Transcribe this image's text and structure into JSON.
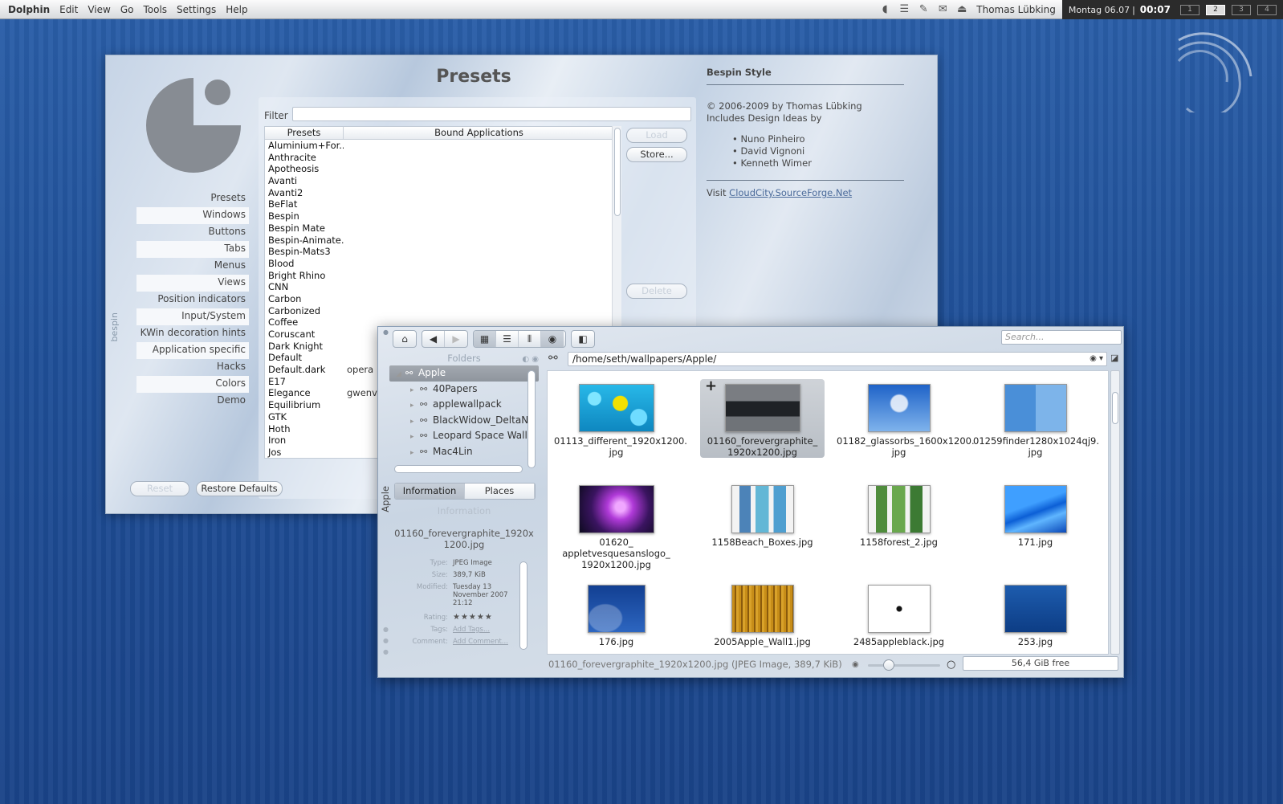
{
  "menubar": {
    "app": "Dolphin",
    "items": [
      "Edit",
      "View",
      "Go",
      "Tools",
      "Settings",
      "Help"
    ]
  },
  "tray": {
    "icons": [
      "volume-icon",
      "clipboard-icon",
      "network-icon",
      "mail-icon",
      "eject-icon"
    ],
    "user": "Thomas Lübking",
    "date": "Montag 06.07",
    "separator": "|",
    "time": "00:07",
    "desktops": [
      "1",
      "2",
      "3",
      "4"
    ],
    "active_desktop": 2
  },
  "config": {
    "title": "Presets",
    "side_label": "bespin",
    "nav": [
      {
        "label": "Presets",
        "alt": false
      },
      {
        "label": "Windows",
        "alt": true
      },
      {
        "label": "Buttons",
        "alt": false
      },
      {
        "label": "Tabs",
        "alt": true
      },
      {
        "label": "Menus",
        "alt": false
      },
      {
        "label": "Views",
        "alt": true
      },
      {
        "label": "Position indicators",
        "alt": false
      },
      {
        "label": "Input/System",
        "alt": true
      },
      {
        "label": "KWin decoration hints",
        "alt": false
      },
      {
        "label": "Application specific",
        "alt": true
      },
      {
        "label": "Hacks",
        "alt": false
      },
      {
        "label": "Colors",
        "alt": true
      },
      {
        "label": "Demo",
        "alt": false
      }
    ],
    "filter_label": "Filter",
    "filter_value": "",
    "columns": [
      "Presets",
      "Bound Applications"
    ],
    "presets": [
      [
        "Aluminium+For...",
        ""
      ],
      [
        "Anthracite",
        ""
      ],
      [
        "Apotheosis",
        ""
      ],
      [
        "Avanti",
        ""
      ],
      [
        "Avanti2",
        ""
      ],
      [
        "BeFlat",
        ""
      ],
      [
        "Bespin",
        ""
      ],
      [
        "Bespin Mate",
        ""
      ],
      [
        "Bespin-Animate...",
        ""
      ],
      [
        "Bespin-Mats3",
        ""
      ],
      [
        "Blood",
        ""
      ],
      [
        "Bright Rhino",
        ""
      ],
      [
        "CNN",
        ""
      ],
      [
        "Carbon",
        ""
      ],
      [
        "Carbonized",
        ""
      ],
      [
        "Coffee",
        ""
      ],
      [
        "Coruscant",
        ""
      ],
      [
        "Dark Knight",
        ""
      ],
      [
        "Default",
        ""
      ],
      [
        "Default.dark",
        "opera"
      ],
      [
        "E17",
        ""
      ],
      [
        "Elegance",
        "gwenview"
      ],
      [
        "Equilibrium",
        ""
      ],
      [
        "GTK",
        ""
      ],
      [
        "Hoth",
        ""
      ],
      [
        "Iron",
        ""
      ],
      [
        "Jos",
        ""
      ]
    ],
    "buttons": {
      "load": "Load",
      "store": "Store...",
      "delete": "Delete",
      "reset": "Reset",
      "restore": "Restore Defaults"
    },
    "about": {
      "title": "Bespin Style",
      "copyright": "© 2006-2009 by Thomas Lübking",
      "ideas": "Includes Design Ideas by",
      "people": [
        "Nuno Pinheiro",
        "David Vignoni",
        "Kenneth Wimer"
      ],
      "visit": "Visit",
      "link": "CloudCity.SourceForge.Net"
    }
  },
  "dolphin": {
    "toolbar": {
      "search_placeholder": "Search..."
    },
    "folders": {
      "title": "Folders",
      "items": [
        {
          "label": "Apple",
          "selected": true,
          "depth": 0
        },
        {
          "label": "40Papers",
          "selected": false,
          "depth": 1
        },
        {
          "label": "applewallpack",
          "selected": false,
          "depth": 1
        },
        {
          "label": "BlackWidow_DeltaN",
          "selected": false,
          "depth": 1
        },
        {
          "label": "Leopard Space Walls",
          "selected": false,
          "depth": 1
        },
        {
          "label": "Mac4Lin",
          "selected": false,
          "depth": 1
        }
      ]
    },
    "vertical_label": "Apple",
    "info_tabs": [
      "Information",
      "Places"
    ],
    "info": {
      "title": "Information",
      "filename": "01160_forevergraphite_1920x1200.jpg",
      "meta": [
        {
          "k": "Type:",
          "v": "JPEG Image"
        },
        {
          "k": "Size:",
          "v": "389,7 KiB"
        },
        {
          "k": "Modified:",
          "v": "Tuesday 13 November 2007 21:12"
        }
      ],
      "rating_label": "Rating:",
      "rating": 0,
      "tags_label": "Tags:",
      "tags_value": "Add Tags...",
      "comment_label": "Comment:",
      "comment_value": "Add Comment..."
    },
    "path": "/home/seth/wallpapers/Apple/",
    "files": [
      {
        "name": "01113_different_1920x1200.\njpg",
        "selected": false,
        "thumb": "blue-balls"
      },
      {
        "name": "01160_forevergraphite_\n1920x1200.jpg",
        "selected": true,
        "thumb": "graphite"
      },
      {
        "name": "01182_glassorbs_1600x1200.\njpg",
        "selected": false,
        "thumb": "glassorbs"
      },
      {
        "name": "01259finder1280x1024qj9.\njpg",
        "selected": false,
        "thumb": "finder"
      },
      {
        "name": "01620_\nappletvesquesanslogo_\n1920x1200.jpg",
        "selected": false,
        "thumb": "appletv"
      },
      {
        "name": "1158Beach_Boxes.jpg",
        "selected": false,
        "thumb": "beach"
      },
      {
        "name": "1158forest_2.jpg",
        "selected": false,
        "thumb": "forest"
      },
      {
        "name": "171.jpg",
        "selected": false,
        "thumb": "blue-wave"
      },
      {
        "name": "176.jpg",
        "selected": false,
        "thumb": "blue-swirl"
      },
      {
        "name": "2005Apple_Wall1.jpg",
        "selected": false,
        "thumb": "wood"
      },
      {
        "name": "2485appleblack.jpg",
        "selected": false,
        "thumb": "white-apple"
      },
      {
        "name": "253.jpg",
        "selected": false,
        "thumb": "apple-blue"
      }
    ],
    "status": "01160_forevergraphite_1920x1200.jpg (JPEG Image, 389,7 KiB)",
    "free_space": "56,4 GiB free",
    "zoom_level": 0.25
  }
}
